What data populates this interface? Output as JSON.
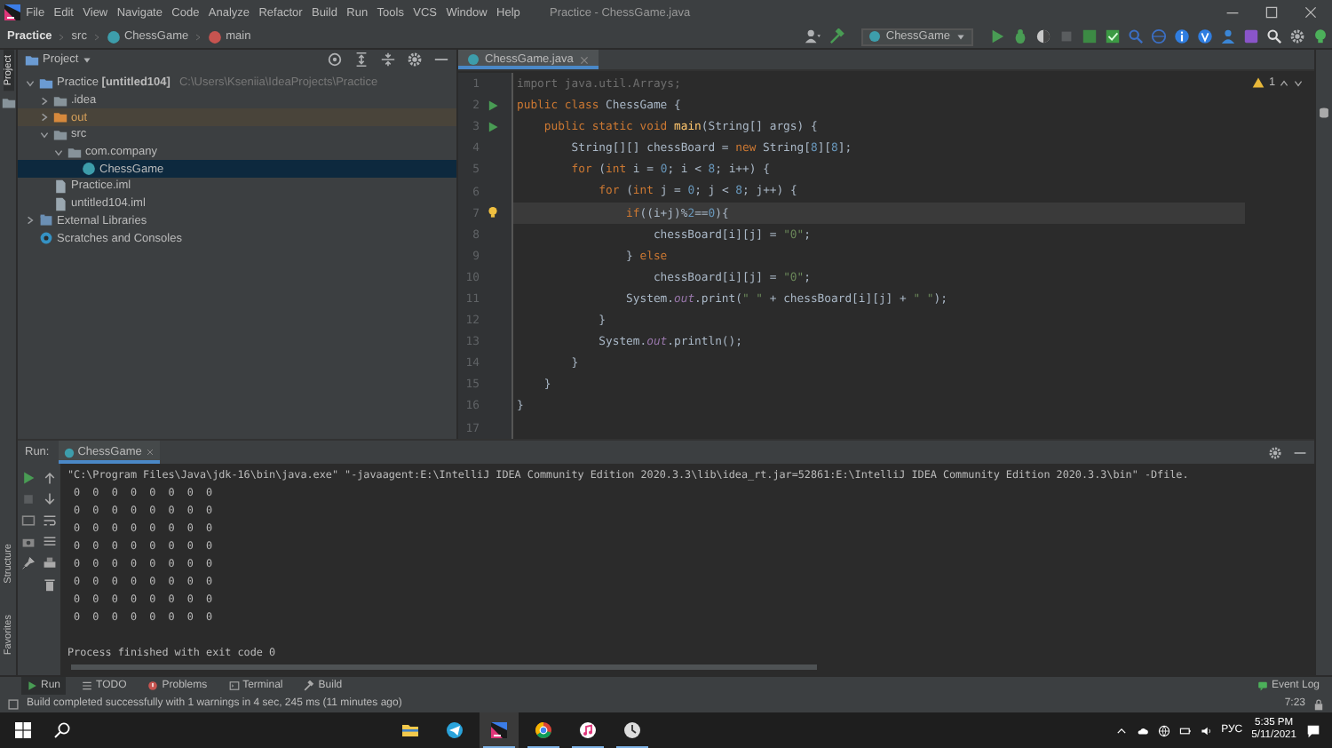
{
  "window": {
    "title": "Practice - ChessGame.java"
  },
  "menu": [
    "File",
    "Edit",
    "View",
    "Navigate",
    "Code",
    "Analyze",
    "Refactor",
    "Build",
    "Run",
    "Tools",
    "VCS",
    "Window",
    "Help"
  ],
  "breadcrumbs": [
    {
      "label": "Practice",
      "kind": "project"
    },
    {
      "label": "src",
      "kind": "folder"
    },
    {
      "label": "ChessGame",
      "kind": "class"
    },
    {
      "label": "main",
      "kind": "method"
    }
  ],
  "toolbar": {
    "run_config": "ChessGame"
  },
  "project": {
    "title": "Project",
    "tree": [
      {
        "label": "Practice",
        "module": "[untitled104]",
        "path": "C:\\Users\\Kseniia\\IdeaProjects\\Practice",
        "kind": "module",
        "expanded": true,
        "selected": false,
        "children": [
          {
            "label": ".idea",
            "kind": "folder",
            "expanded": false,
            "selected": false
          },
          {
            "label": "out",
            "kind": "excluded",
            "expanded": false,
            "selected": false
          },
          {
            "label": "src",
            "kind": "folder",
            "expanded": true,
            "selected": false,
            "children": [
              {
                "label": "com.company",
                "kind": "package",
                "expanded": true,
                "selected": false,
                "children": [
                  {
                    "label": "ChessGame",
                    "kind": "class",
                    "selected": true
                  }
                ]
              }
            ]
          },
          {
            "label": "Practice.iml",
            "kind": "file",
            "selected": false
          },
          {
            "label": "untitled104.iml",
            "kind": "file",
            "selected": false
          }
        ]
      },
      {
        "label": "External Libraries",
        "kind": "library",
        "expanded": false,
        "selected": false
      },
      {
        "label": "Scratches and Consoles",
        "kind": "scratches",
        "selected": false
      }
    ]
  },
  "editor": {
    "tabs": [
      {
        "label": "ChessGame.java",
        "selected": true
      }
    ],
    "warnings": "1",
    "lines": [
      {
        "no": "1",
        "kind": "plain",
        "current": false,
        "tokens": [
          {
            "text": "import java.util.Arrays;",
            "kind": "unused"
          }
        ]
      },
      {
        "no": "2",
        "kind": "runnable",
        "current": false,
        "tokens": [
          {
            "text": "public class ",
            "kind": "keyword"
          },
          {
            "text": "ChessGame {",
            "kind": "plain"
          }
        ]
      },
      {
        "no": "3",
        "kind": "runnable",
        "current": false,
        "tokens": [
          {
            "text": "    public static void ",
            "kind": "keyword"
          },
          {
            "text": "main",
            "kind": "method"
          },
          {
            "text": "(String[] args) {",
            "kind": "plain"
          }
        ]
      },
      {
        "no": "4",
        "kind": "plain",
        "current": false,
        "tokens": [
          {
            "text": "        String[][] chessBoard = ",
            "kind": "plain"
          },
          {
            "text": "new",
            "kind": "keyword"
          },
          {
            "text": " String[",
            "kind": "plain"
          },
          {
            "text": "8",
            "kind": "number"
          },
          {
            "text": "][",
            "kind": "plain"
          },
          {
            "text": "8",
            "kind": "number"
          },
          {
            "text": "];",
            "kind": "plain"
          }
        ]
      },
      {
        "no": "5",
        "kind": "plain",
        "current": false,
        "tokens": [
          {
            "text": "        for",
            "kind": "keyword"
          },
          {
            "text": " (",
            "kind": "plain"
          },
          {
            "text": "int",
            "kind": "keyword"
          },
          {
            "text": " i = ",
            "kind": "plain"
          },
          {
            "text": "0",
            "kind": "number"
          },
          {
            "text": "; i < ",
            "kind": "plain"
          },
          {
            "text": "8",
            "kind": "number"
          },
          {
            "text": "; i++) {",
            "kind": "plain"
          }
        ]
      },
      {
        "no": "6",
        "kind": "plain",
        "current": false,
        "tokens": [
          {
            "text": "            for",
            "kind": "keyword"
          },
          {
            "text": " (",
            "kind": "plain"
          },
          {
            "text": "int",
            "kind": "keyword"
          },
          {
            "text": " j = ",
            "kind": "plain"
          },
          {
            "text": "0",
            "kind": "number"
          },
          {
            "text": "; j < ",
            "kind": "plain"
          },
          {
            "text": "8",
            "kind": "number"
          },
          {
            "text": "; j++) {",
            "kind": "plain"
          }
        ]
      },
      {
        "no": "7",
        "kind": "hint",
        "current": true,
        "tokens": [
          {
            "text": "                if",
            "kind": "keyword"
          },
          {
            "text": "((i+j)%",
            "kind": "plain"
          },
          {
            "text": "2",
            "kind": "number"
          },
          {
            "text": "==",
            "kind": "plain"
          },
          {
            "text": "0",
            "kind": "number"
          },
          {
            "text": "){",
            "kind": "plain"
          }
        ]
      },
      {
        "no": "8",
        "kind": "plain",
        "current": false,
        "tokens": [
          {
            "text": "                    chessBoard[i][j] = ",
            "kind": "plain"
          },
          {
            "text": "\"0\"",
            "kind": "string"
          },
          {
            "text": ";",
            "kind": "plain"
          }
        ]
      },
      {
        "no": "9",
        "kind": "plain",
        "current": false,
        "tokens": [
          {
            "text": "                } ",
            "kind": "plain"
          },
          {
            "text": "else",
            "kind": "keyword"
          }
        ]
      },
      {
        "no": "10",
        "kind": "plain",
        "current": false,
        "tokens": [
          {
            "text": "                    chessBoard[i][j] = ",
            "kind": "plain"
          },
          {
            "text": "\"0\"",
            "kind": "string"
          },
          {
            "text": ";",
            "kind": "plain"
          }
        ]
      },
      {
        "no": "11",
        "kind": "plain",
        "current": false,
        "tokens": [
          {
            "text": "                System.",
            "kind": "plain"
          },
          {
            "text": "out",
            "kind": "field"
          },
          {
            "text": ".print(",
            "kind": "plain"
          },
          {
            "text": "\" \"",
            "kind": "string"
          },
          {
            "text": " + chessBoard[i][j] + ",
            "kind": "plain"
          },
          {
            "text": "\" \"",
            "kind": "string"
          },
          {
            "text": ");",
            "kind": "plain"
          }
        ]
      },
      {
        "no": "12",
        "kind": "plain",
        "current": false,
        "tokens": [
          {
            "text": "            }",
            "kind": "plain"
          }
        ]
      },
      {
        "no": "13",
        "kind": "plain",
        "current": false,
        "tokens": [
          {
            "text": "            System.",
            "kind": "plain"
          },
          {
            "text": "out",
            "kind": "field"
          },
          {
            "text": ".println();",
            "kind": "plain"
          }
        ]
      },
      {
        "no": "14",
        "kind": "plain",
        "current": false,
        "tokens": [
          {
            "text": "        }",
            "kind": "plain"
          }
        ]
      },
      {
        "no": "15",
        "kind": "plain",
        "current": false,
        "tokens": [
          {
            "text": "    }",
            "kind": "plain"
          }
        ]
      },
      {
        "no": "16",
        "kind": "plain",
        "current": false,
        "tokens": [
          {
            "text": "}",
            "kind": "plain"
          }
        ]
      },
      {
        "no": "17",
        "kind": "plain",
        "current": false
      }
    ]
  },
  "run": {
    "label": "Run:",
    "tabs": [
      {
        "label": "ChessGame",
        "selected": true
      }
    ],
    "console": [
      "\"C:\\Program Files\\Java\\jdk-16\\bin\\java.exe\" \"-javaagent:E:\\IntelliJ IDEA Community Edition 2020.3.3\\lib\\idea_rt.jar=52861:E:\\IntelliJ IDEA Community Edition 2020.3.3\\bin\" -Dfile.",
      " 0  0  0  0  0  0  0  0 ",
      " 0  0  0  0  0  0  0  0 ",
      " 0  0  0  0  0  0  0  0 ",
      " 0  0  0  0  0  0  0  0 ",
      " 0  0  0  0  0  0  0  0 ",
      " 0  0  0  0  0  0  0  0 ",
      " 0  0  0  0  0  0  0  0 ",
      " 0  0  0  0  0  0  0  0 ",
      "Process finished with exit code 0"
    ]
  },
  "side_tabs": {
    "left_top": "Project",
    "left_bottom": [
      "Structure",
      "Favorites"
    ]
  },
  "tool_windows": [
    {
      "label": "Run",
      "kind": "run",
      "selected": true
    },
    {
      "label": "TODO",
      "kind": "todo",
      "selected": false
    },
    {
      "label": "Problems",
      "kind": "problems",
      "selected": false
    },
    {
      "label": "Terminal",
      "kind": "terminal",
      "selected": false
    },
    {
      "label": "Build",
      "kind": "build",
      "selected": false
    }
  ],
  "event_log": "Event Log",
  "status_bar": {
    "message": "Build completed successfully with 1 warnings in 4 sec, 245 ms (11 minutes ago)",
    "position": "7:23"
  },
  "taskbar": {
    "apps": [
      {
        "kind": "explorer",
        "running": false,
        "active": false
      },
      {
        "kind": "telegram",
        "running": false,
        "active": false
      },
      {
        "kind": "intellij",
        "running": true,
        "active": true
      },
      {
        "kind": "chrome",
        "running": true,
        "active": false
      },
      {
        "kind": "itunes",
        "running": true,
        "active": false
      },
      {
        "kind": "clock",
        "running": true,
        "active": false
      }
    ],
    "language": "РУС",
    "time": "5:35 PM",
    "date": "5/11/2021"
  }
}
